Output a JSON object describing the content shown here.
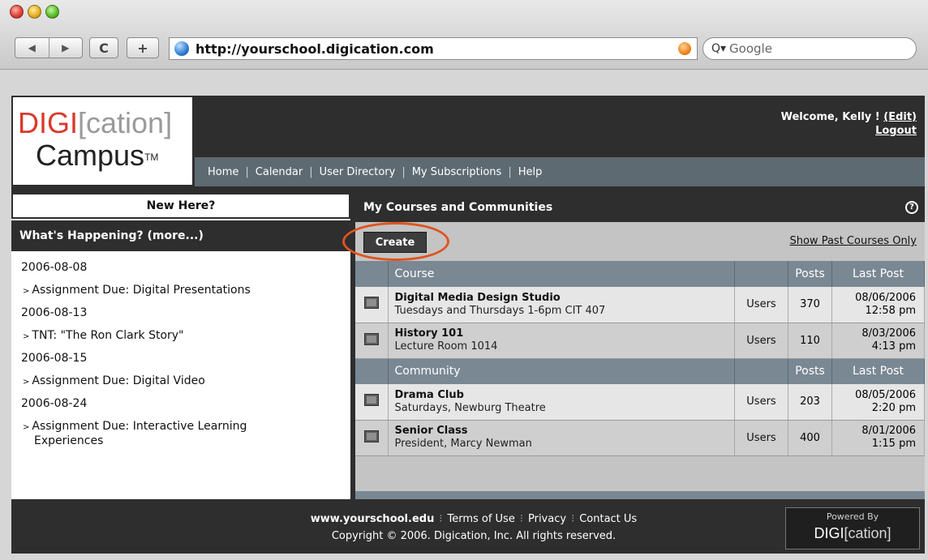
{
  "browser": {
    "url": "http://yourschool.digication.com",
    "search_placeholder": "Google",
    "back_label": "◀",
    "forward_label": "▶",
    "reload_label": "C",
    "add_label": "+"
  },
  "logo": {
    "digi": "DIGI",
    "cation": "[cation]",
    "campus": "Campus",
    "tm": "TM"
  },
  "welcome": {
    "text": "Welcome, Kelly ! ",
    "edit": "(Edit)",
    "logout": "Logout"
  },
  "nav": [
    "Home",
    "Calendar",
    "User Directory",
    "My Subscriptions",
    "Help"
  ],
  "left": {
    "new_here": "New Here?",
    "whats_happening": "What's Happening? (more...)",
    "events": [
      {
        "date": "2006-08-08",
        "item": "Assignment Due: Digital Presentations",
        "cont": ""
      },
      {
        "date": "2006-08-13",
        "item": "TNT: \"The Ron Clark Story\"",
        "cont": ""
      },
      {
        "date": "2006-08-15",
        "item": "Assignment Due: Digital Video",
        "cont": ""
      },
      {
        "date": "2006-08-24",
        "item": "Assignment Due: Interactive Learning",
        "cont": "Experiences"
      }
    ]
  },
  "right": {
    "title": "My Courses and Communities",
    "help": "?",
    "create": "Create",
    "show_past": "Show Past Courses Only",
    "course_header": {
      "name": "Course",
      "posts": "Posts",
      "last": "Last Post"
    },
    "courses": [
      {
        "name": "Digital Media Design Studio",
        "desc": "Tuesdays and Thursdays 1-6pm CIT 407",
        "users": "Users",
        "posts": "370",
        "date": "08/06/2006",
        "time": "12:58 pm"
      },
      {
        "name": "History 101",
        "desc": "Lecture Room 1014",
        "users": "Users",
        "posts": "110",
        "date": "8/03/2006",
        "time": "4:13 pm"
      }
    ],
    "community_header": {
      "name": "Community",
      "posts": "Posts",
      "last": "Last Post"
    },
    "communities": [
      {
        "name": "Drama Club",
        "desc": "Saturdays, Newburg Theatre",
        "users": "Users",
        "posts": "203",
        "date": "08/05/2006",
        "time": "2:20 pm"
      },
      {
        "name": "Senior Class",
        "desc": "President, Marcy Newman",
        "users": "Users",
        "posts": "400",
        "date": "8/01/2006",
        "time": "1:15 pm"
      }
    ]
  },
  "footer": {
    "links": [
      "www.yourschool.edu",
      "Terms of Use",
      "Privacy",
      "Contact Us"
    ],
    "copyright": "Copyright © 2006. Digication, Inc. All rights reserved.",
    "powered_by": "Powered By",
    "powered_digi": "DIGI",
    "powered_cation": "[cation]"
  }
}
